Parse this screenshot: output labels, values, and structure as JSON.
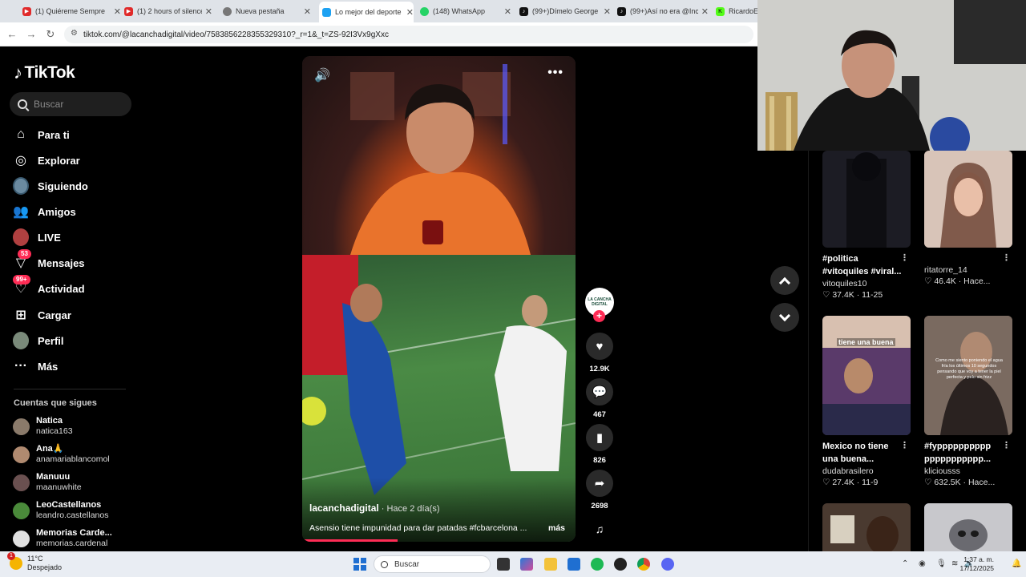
{
  "browser": {
    "tabs": [
      {
        "label": "(1) Quiéreme Sempre",
        "icon": "youtube-icon",
        "color": "#e02a2a"
      },
      {
        "label": "(1) 2 hours of silence",
        "icon": "youtube-icon",
        "color": "#e02a2a"
      },
      {
        "label": "Nueva pestaña",
        "icon": "chrome-icon",
        "color": "#555555"
      },
      {
        "label": "Lo mejor del deporte",
        "icon": "site-icon",
        "color": "#1da1f2"
      },
      {
        "label": "(148) WhatsApp",
        "icon": "whatsapp-icon",
        "color": "#25d366"
      },
      {
        "label": "(99+)Dímelo George",
        "icon": "tiktok-icon",
        "color": "#111111"
      },
      {
        "label": "(99+)Así no era @Inc",
        "icon": "tiktok-icon",
        "color": "#111111"
      },
      {
        "label": "RicardoEs",
        "icon": "kick-icon",
        "color": "#53fc18"
      }
    ],
    "url": "tiktok.com/@lacanchadigital/video/7583856228355329310?_r=1&_t=ZS-92I3Vx9gXxc"
  },
  "sidebar": {
    "brand": "TikTok",
    "search_placeholder": "Buscar",
    "nav": [
      {
        "label": "Para ti",
        "icon": "home-icon"
      },
      {
        "label": "Explorar",
        "icon": "compass-icon"
      },
      {
        "label": "Siguiendo",
        "icon": "following-avatar-icon"
      },
      {
        "label": "Amigos",
        "icon": "friends-icon"
      },
      {
        "label": "LIVE",
        "icon": "live-icon"
      },
      {
        "label": "Mensajes",
        "icon": "messages-icon",
        "badge": "53"
      },
      {
        "label": "Actividad",
        "icon": "activity-icon",
        "badge": "99+"
      },
      {
        "label": "Cargar",
        "icon": "upload-icon"
      },
      {
        "label": "Perfil",
        "icon": "profile-icon"
      },
      {
        "label": "Más",
        "icon": "more-icon"
      }
    ],
    "following_title": "Cuentas que sigues",
    "following": [
      {
        "name": "Natica",
        "handle": "natica163",
        "color": "#8a7a6a"
      },
      {
        "name": "Ana🙏",
        "handle": "anamariablancomol",
        "color": "#b08a70"
      },
      {
        "name": "Manuuu",
        "handle": "maanuwhite",
        "color": "#6a5050"
      },
      {
        "name": "LeoCastellanos",
        "handle": "leandro.castellanos",
        "color": "#4a8a3a"
      },
      {
        "name": "Memorias Carde...",
        "handle": "memorias.cardenal",
        "color": "#e0e0e0"
      }
    ]
  },
  "video": {
    "author": "lacanchadigital",
    "when": " · Hace 2 día(s)",
    "caption": "Asensio tiene impunidad para dar patadas #fcbarcelona ...",
    "more": "más",
    "progress": 0.35,
    "creator_avatar_text": "LA CANCHA DIGITAL",
    "likes": "12.9K",
    "comments": "467",
    "saves": "826",
    "shares": "2698"
  },
  "recommendations": [
    {
      "title": "#politica #vitoquiles #viral...",
      "author": "vitoquiles10",
      "likes": "37.4K",
      "date": "11-25",
      "color": "#1c1c24"
    },
    {
      "title": "",
      "author": "ritatorre_14",
      "likes": "46.4K",
      "date": "Hace...",
      "color": "#c9a896"
    },
    {
      "title": "Mexico no tiene una buena...",
      "author": "dudabrasilero",
      "likes": "27.4K",
      "date": "11-9",
      "color": "#4a3a5a",
      "overlay": "tiene una buena"
    },
    {
      "title": "#fypppppppppp ppppppppppp...",
      "author": "kliciousss",
      "likes": "632.5K",
      "date": "Hace...",
      "color": "#6a5248",
      "overlay": "Como me siento poniendo el agua fría los últimos 10 segundos pensando que voy a tener la piel perfecta y pelo sin frizz"
    },
    {
      "title": "",
      "author": "",
      "likes": "",
      "date": "",
      "color": "#3a2e28"
    },
    {
      "title": "",
      "author": "",
      "likes": "",
      "date": "",
      "color": "#bfbfc2"
    }
  ],
  "taskbar": {
    "temp": "11°C",
    "weather": "Despejado",
    "weather_badge": "1",
    "search_placeholder": "Buscar",
    "time": "1:37 a. m.",
    "date": "17/12/2025"
  }
}
